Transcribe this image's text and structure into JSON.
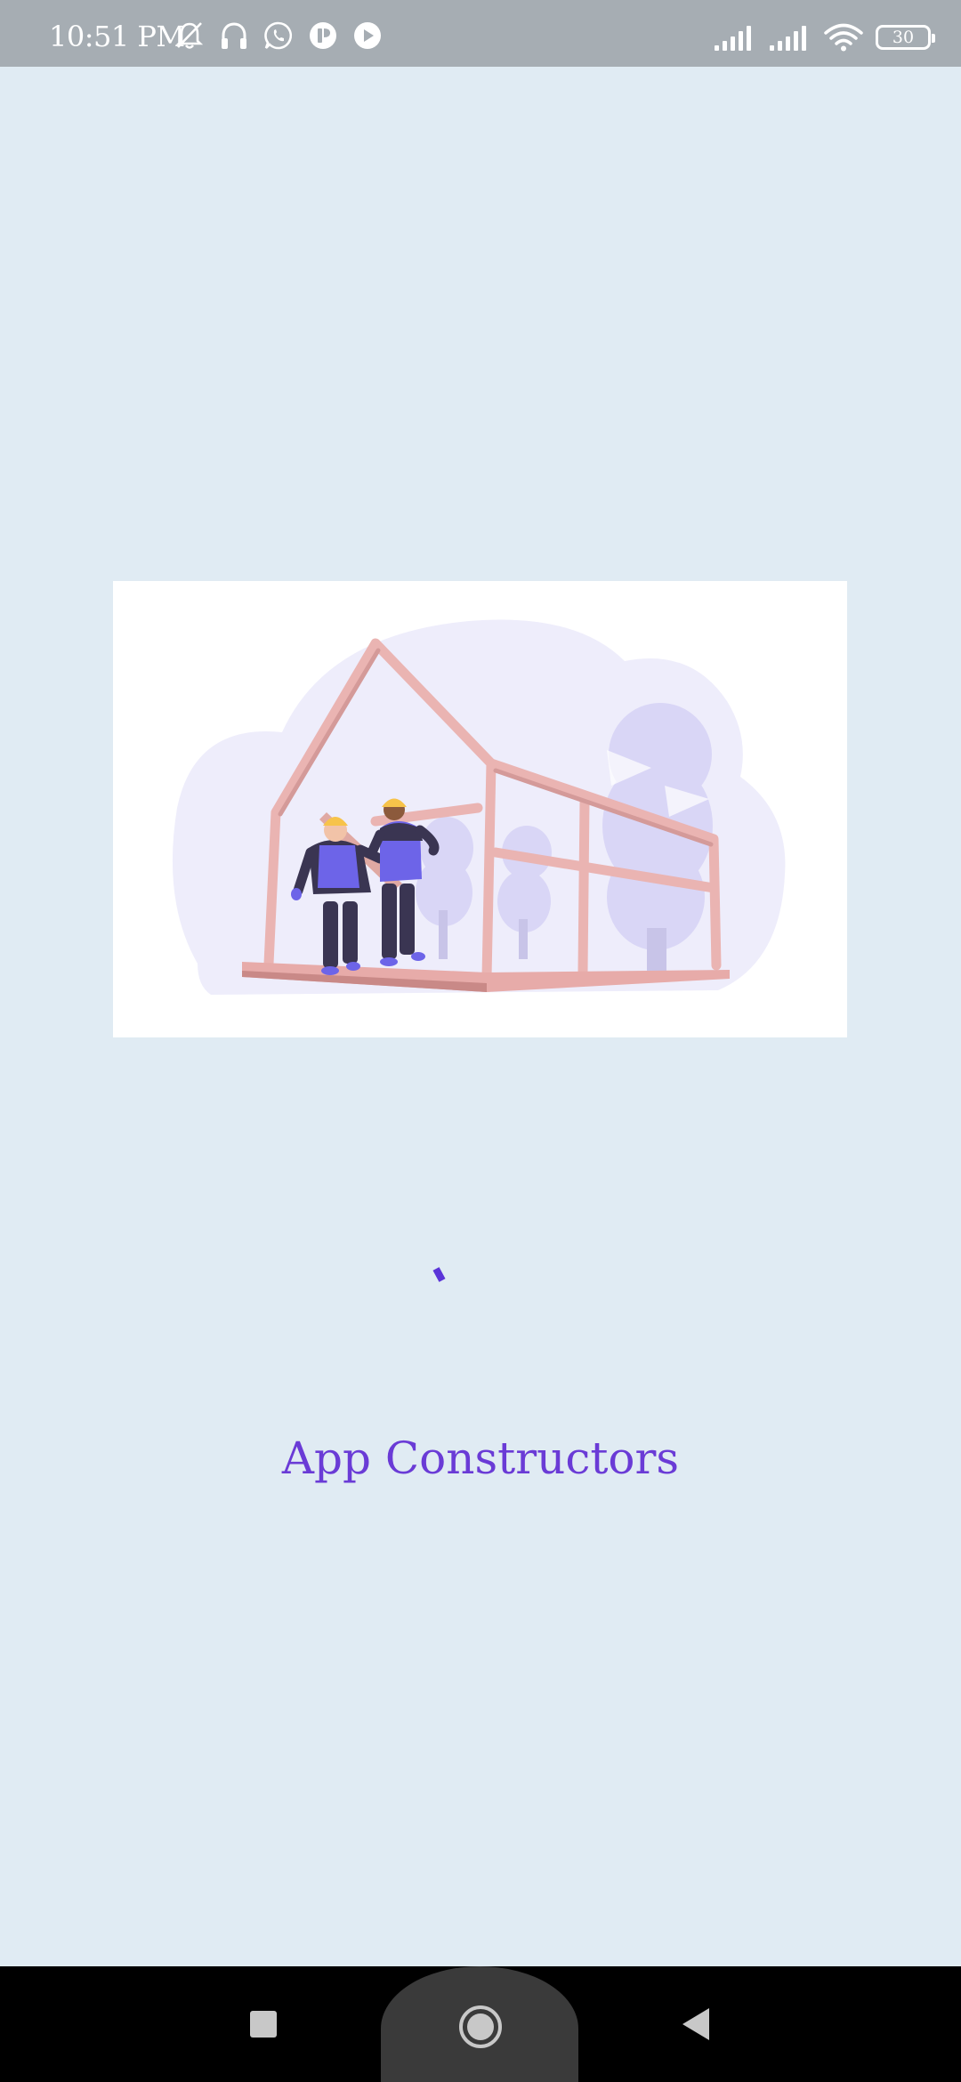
{
  "status_bar": {
    "time": "10:51 PM",
    "battery_level": "30",
    "icons_left": [
      "bell-muted-icon",
      "headphones-icon",
      "whatsapp-icon",
      "app-notification-icon",
      "play-icon"
    ],
    "icons_right": [
      "signal-icon",
      "signal-icon",
      "wifi-icon",
      "battery-icon"
    ]
  },
  "splash": {
    "app_name": "App Constructors",
    "illustration": "construction-workers-house-frame",
    "loading": true
  },
  "nav_bar": {
    "buttons": [
      "recents-button",
      "home-button",
      "back-button"
    ]
  },
  "colors": {
    "background": "#e0ebf3",
    "status_bar": "#a6adb3",
    "accent": "#6a3bd6",
    "nav_bar": "#000000"
  }
}
